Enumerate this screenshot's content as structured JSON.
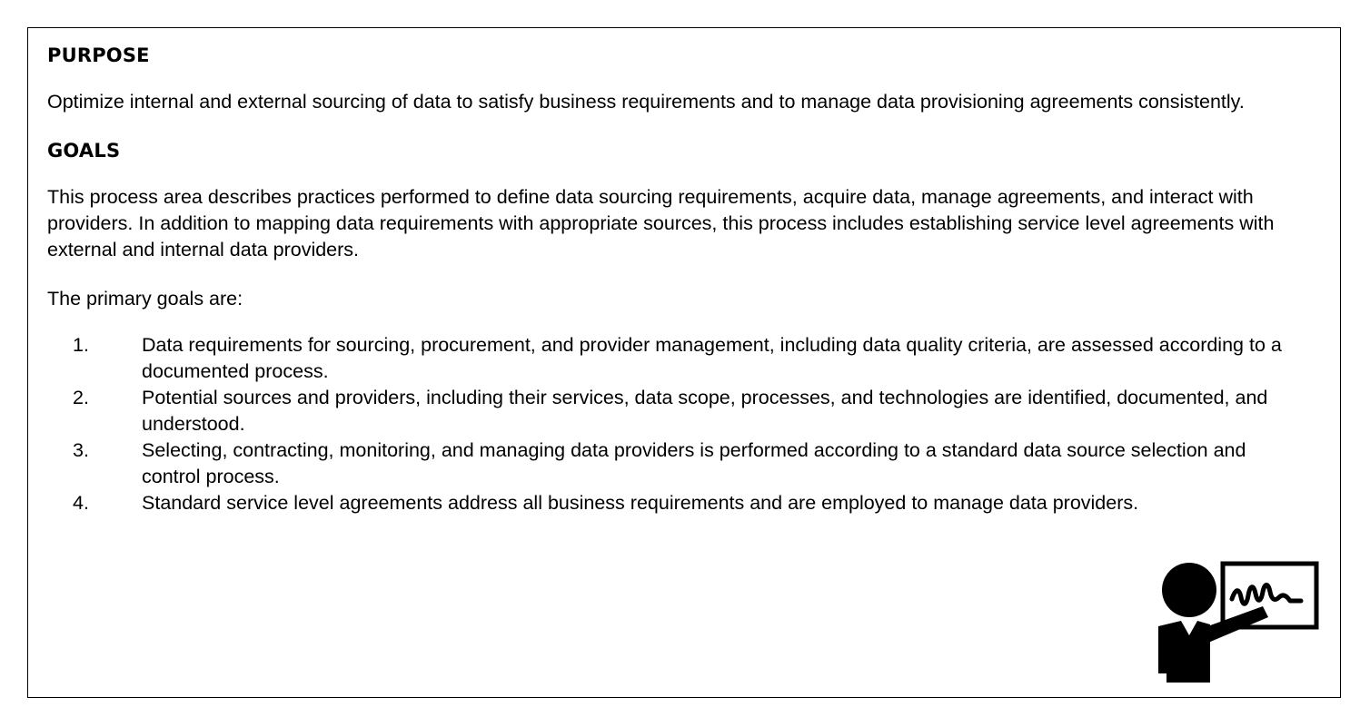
{
  "purpose": {
    "heading": "PURPOSE",
    "text": "Optimize internal and external sourcing of data to satisfy business requirements and to manage data provisioning agreements consistently."
  },
  "goals": {
    "heading": "GOALS",
    "intro": "This process area describes practices performed to define data sourcing requirements, acquire data, manage agreements, and interact with providers. In addition to mapping data requirements with appropriate sources, this process includes establishing service level agreements with external and internal data providers.",
    "lead": "The primary goals are:",
    "items": [
      {
        "number": "1.",
        "text": "Data requirements for sourcing, procurement, and provider management, including data quality criteria, are assessed according to a documented process."
      },
      {
        "number": "2.",
        "text": "Potential sources and providers, including their services, data scope, processes, and technologies are identified, documented, and understood."
      },
      {
        "number": "3.",
        "text": "Selecting, contracting, monitoring, and managing data providers is performed according to a standard data source selection and control process."
      },
      {
        "number": "4.",
        "text": "Standard service level agreements address all business requirements and are employed to manage data providers."
      }
    ]
  },
  "icons": {
    "presenter": "teacher-presenting-icon"
  }
}
